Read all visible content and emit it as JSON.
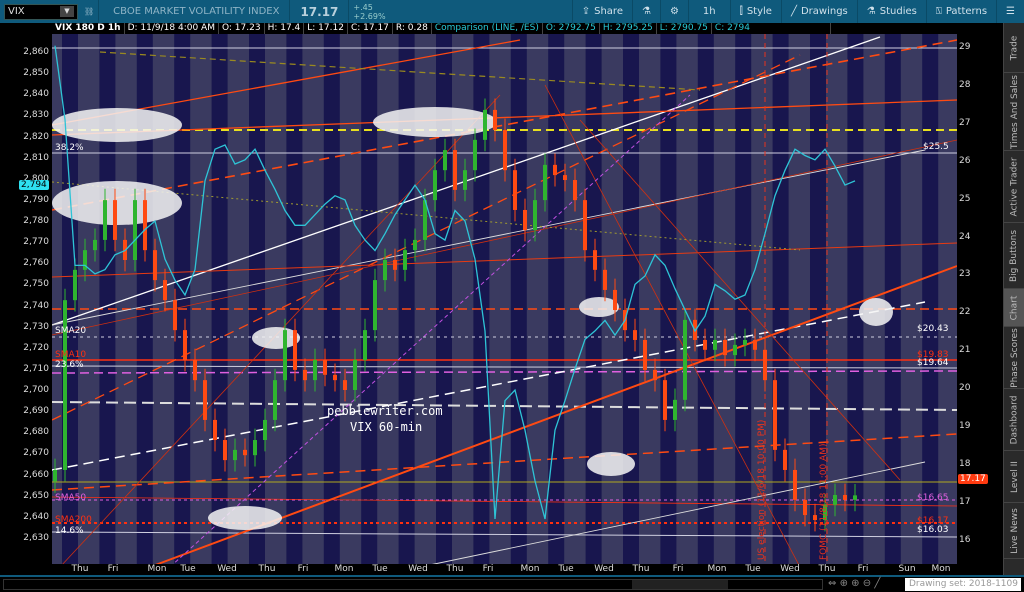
{
  "toolbar": {
    "symbol": "VIX",
    "description": "CBOE MARKET VOLATILITY INDEX",
    "last": "17.17",
    "change": "+.45",
    "change_pct": "+2.69%",
    "share": "Share",
    "timeframe": "1h",
    "style": "Style",
    "drawings": "Drawings",
    "studies": "Studies",
    "patterns": "Patterns"
  },
  "info": {
    "title": "VIX 180 D 1h",
    "date": "D: 11/9/18 4:00 AM",
    "open": "O: 17.23",
    "high": "H: 17.4",
    "low": "L: 17.12",
    "close": "C: 17.17",
    "range": "R: 0.28",
    "comparison": "Comparison (LINE, /ES)",
    "c_open": "O: 2792.75",
    "c_high": "H: 2795.25",
    "c_low": "L: 2790.75",
    "c_close": "C: 2794"
  },
  "sidebar": [
    "Trade",
    "Times And Sales",
    "Active Trader",
    "Big Buttons",
    "Chart",
    "Phase Scores",
    "Dashboard",
    "Level II",
    "Live News"
  ],
  "bottom": {
    "drawing_set": "Drawing set: 2018-1109"
  },
  "annotations": {
    "fib382": "38.2%",
    "sma20": "SMA20",
    "sma10": "SMA10",
    "fib236": "23.6%",
    "sma50": "SMA50",
    "sma200": "SMA200",
    "fib146": "14.6%",
    "r255": "$25.5",
    "r2043": "$20.43",
    "r1983": "$19.83",
    "r1964": "$19.64",
    "r1665": "$16.65",
    "r1617": "$16.17",
    "r1603": "$16.03",
    "es_badge": "2,794",
    "vix_badge": "17.17",
    "watermark1": "pebblewriter.com",
    "watermark2": "VIX 60-min",
    "event1": "US election (11/6/18 10:00 PM)",
    "event2": "FOMC (11/8/18 11:00 AM)"
  },
  "colors": {
    "up": "#2fb52f",
    "down": "#ff4a12",
    "comparison": "#2ec4d6",
    "accent": "#0f5a7c"
  },
  "chart_data": {
    "type": "candlestick+line",
    "title": "VIX 180 D 1h",
    "left_axis": {
      "label": "/ES",
      "ticks": [
        2630,
        2640,
        2650,
        2660,
        2670,
        2680,
        2690,
        2700,
        2710,
        2720,
        2730,
        2740,
        2750,
        2760,
        2770,
        2780,
        2790,
        2800,
        2810,
        2820,
        2830,
        2840,
        2850,
        2860
      ],
      "tick_labels": [
        "2,630",
        "2,640",
        "2,650",
        "2,660",
        "2,670",
        "2,680",
        "2,690",
        "2,700",
        "2,710",
        "2,720",
        "2,730",
        "2,740",
        "2,750",
        "2,760",
        "2,770",
        "2,780",
        "2,790",
        "2,800",
        "2,810",
        "2,820",
        "2,830",
        "2,840",
        "2,850",
        "2,860"
      ],
      "range": [
        2620,
        2870
      ]
    },
    "right_axis": {
      "label": "VIX",
      "ticks": [
        "16",
        "17",
        "18",
        "19",
        "20",
        "21",
        "22",
        "23",
        "24",
        "25",
        "26",
        "27",
        "28",
        "29"
      ],
      "range": [
        15.5,
        29.6
      ]
    },
    "x_labels": [
      "Thu",
      "Fri",
      "Mon",
      "Tue",
      "Wed",
      "Thu",
      "Fri",
      "Mon",
      "Tue",
      "Wed",
      "Thu",
      "Fri",
      "Mon",
      "Tue",
      "Wed",
      "Thu",
      "Fri",
      "Mon",
      "Tue",
      "Wed",
      "Thu",
      "Fri",
      "Sun",
      "Mon"
    ],
    "vix_closes": [
      17.84,
      22.32,
      23.12,
      23.64,
      23.91,
      24.96,
      23.91,
      23.38,
      24.96,
      23.64,
      22.85,
      22.32,
      21.53,
      20.74,
      20.21,
      19.16,
      18.63,
      18.1,
      18.37,
      18.23,
      18.63,
      19.16,
      20.21,
      21.53,
      20.48,
      20.21,
      20.74,
      20.35,
      20.21,
      19.95,
      20.74,
      21.53,
      22.85,
      23.38,
      23.12,
      23.64,
      23.91,
      24.96,
      25.75,
      26.28,
      25.23,
      25.75,
      26.55,
      27.34,
      26.81,
      25.75,
      24.7,
      24.17,
      24.96,
      25.89,
      25.62,
      25.49,
      24.96,
      23.64,
      23.12,
      22.59,
      22.06,
      21.53,
      21.27,
      20.48,
      20.21,
      19.16,
      19.69,
      21.8,
      21.27,
      21.01,
      21.27,
      20.87,
      21.14,
      21.27,
      21.01,
      20.21,
      18.37,
      17.84,
      17.05,
      16.65,
      16.52,
      16.92,
      17.18,
      17.05,
      17.17
    ],
    "es_comparison": [
      2863,
      2828,
      2759,
      2759,
      2755,
      2757,
      2764,
      2766,
      2771,
      2776,
      2780,
      2762,
      2752,
      2745,
      2757,
      2799,
      2814,
      2816,
      2807,
      2809,
      2814,
      2804,
      2795,
      2785,
      2778,
      2778,
      2783,
      2788,
      2792,
      2790,
      2778,
      2771,
      2766,
      2774,
      2783,
      2790,
      2797,
      2790,
      2774,
      2771,
      2785,
      2780,
      2762,
      2728,
      2639,
      2695,
      2700,
      2681,
      2657,
      2639,
      2681,
      2695,
      2710,
      2724,
      2728,
      2733,
      2726,
      2733,
      2750,
      2754,
      2764,
      2759,
      2748,
      2738,
      2728,
      2735,
      2750,
      2747,
      2743,
      2745,
      2757,
      2774,
      2792,
      2804,
      2814,
      2811,
      2809,
      2814,
      2806,
      2797,
      2799
    ]
  }
}
